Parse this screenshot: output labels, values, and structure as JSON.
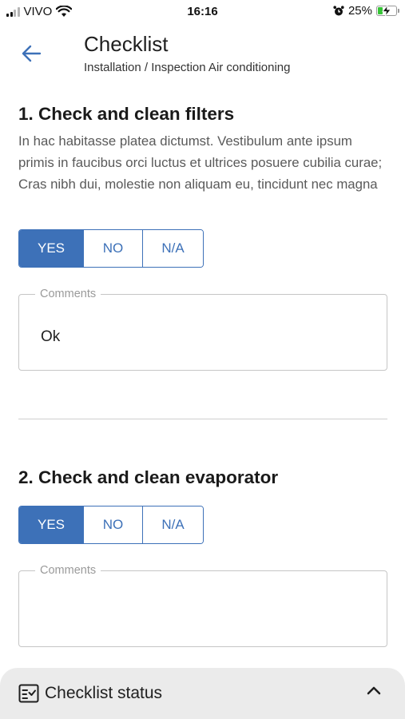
{
  "status_bar": {
    "carrier": "VIVO",
    "time": "16:16",
    "battery_percent": "25%",
    "battery_level": 0.25,
    "icons": [
      "signal-icon",
      "wifi-icon",
      "alarm-icon",
      "battery-charging-icon"
    ]
  },
  "header": {
    "back_icon": "arrow-left-icon",
    "title": "Checklist",
    "subtitle": "Installation / Inspection Air conditioning"
  },
  "items": [
    {
      "title": "1. Check and clean filters",
      "description": "In hac habitasse platea dictumst. Vestibulum ante ipsum primis in faucibus orci luctus et ultrices posuere cubilia curae; Cras nibh dui, molestie non aliquam eu, tincidunt nec magna",
      "options": [
        "YES",
        "NO",
        "N/A"
      ],
      "selected": "YES",
      "comments_label": "Comments",
      "comments_value": "Ok"
    },
    {
      "title": "2. Check and clean evaporator",
      "options": [
        "YES",
        "NO",
        "N/A"
      ],
      "selected": "YES",
      "comments_label": "Comments",
      "comments_value": ""
    }
  ],
  "bottom_sheet": {
    "icon": "checklist-icon",
    "label": "Checklist status",
    "chevron_icon": "chevron-up-icon"
  },
  "colors": {
    "accent": "#3d71b8",
    "bottom_sheet_bg": "#ebebeb",
    "battery_fill": "#37c437"
  }
}
